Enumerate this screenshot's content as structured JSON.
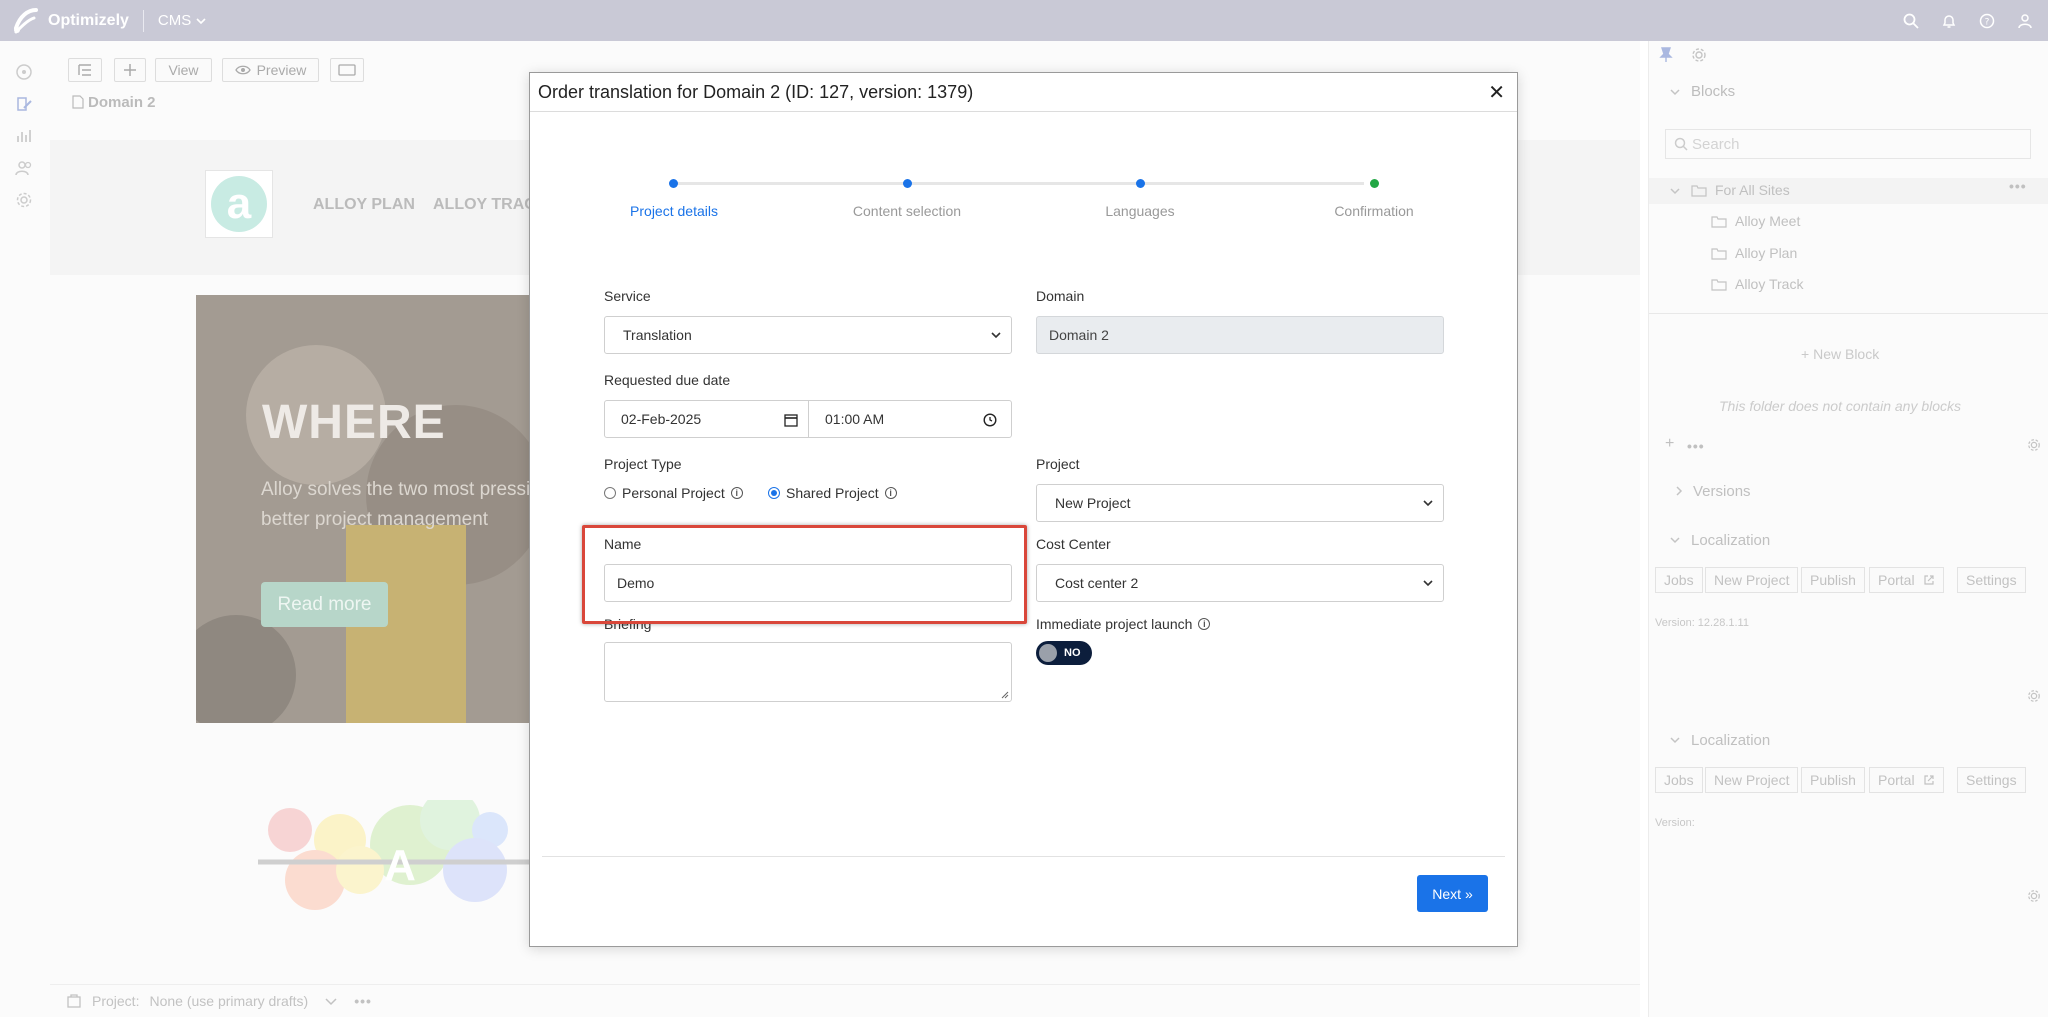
{
  "topbar": {
    "brand": "Optimizely",
    "product": "CMS"
  },
  "editor": {
    "toolbar_view": "View",
    "toolbar_preview": "Preview",
    "page_name": "Domain 2",
    "site_nav": [
      "ALLOY PLAN",
      "ALLOY TRAC"
    ],
    "hero_title": "WHERE",
    "hero_text_1": "Alloy solves the two most pressi",
    "hero_text_2": "better project management",
    "hero_button": "Read more",
    "bottom_project_label": "Project:",
    "bottom_project_value": "None (use primary drafts)"
  },
  "right_pane": {
    "blocks_title": "Blocks",
    "search_placeholder": "Search",
    "tree_root": "For All Sites",
    "tree_children": [
      "Alloy Meet",
      "Alloy Plan",
      "Alloy Track"
    ],
    "new_block": "New Block",
    "empty_text": "This folder does not contain any blocks",
    "versions": "Versions",
    "localization": "Localization",
    "loc_buttons": [
      "Jobs",
      "New Project",
      "Publish",
      "Portal",
      "Settings"
    ],
    "version_text_1": "Version: 12.28.1.11",
    "version_text_2": "Version:"
  },
  "modal": {
    "title": "Order translation for Domain 2 (ID: 127, version: 1379)",
    "steps": [
      "Project details",
      "Content selection",
      "Languages",
      "Confirmation"
    ],
    "active_step": "Project details",
    "service_label": "Service",
    "service_value": "Translation",
    "domain_label": "Domain",
    "domain_value": "Domain 2",
    "due_date_label": "Requested due date",
    "due_date_value": "02-Feb-2025",
    "due_time_value": "01:00 AM",
    "project_type_label": "Project Type",
    "project_type_options": [
      "Personal Project",
      "Shared Project"
    ],
    "project_type_selected": "Shared Project",
    "project_label": "Project",
    "project_value": "New Project",
    "name_label": "Name",
    "name_value": "Demo",
    "cost_center_label": "Cost Center",
    "cost_center_value": "Cost center 2",
    "briefing_label": "Briefing",
    "briefing_value": "",
    "immediate_launch_label": "Immediate project launch",
    "immediate_launch_value": "NO",
    "next_button": "Next »",
    "colors": {
      "accent": "#1a73e8",
      "confirm_dot": "#22a745",
      "highlight": "#d9473a",
      "toggle_bg": "#0c1e3c"
    }
  }
}
